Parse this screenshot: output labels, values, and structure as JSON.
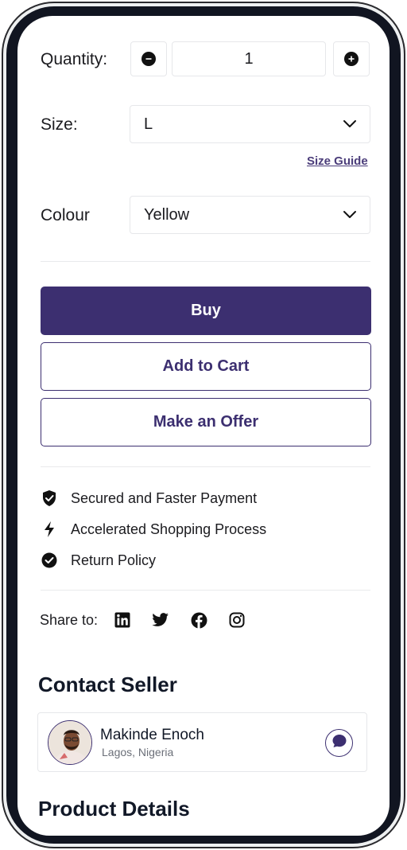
{
  "quantity": {
    "label": "Quantity:",
    "value": "1",
    "decrease_icon": "minus-circle-icon",
    "increase_icon": "plus-circle-icon"
  },
  "size": {
    "label": "Size:",
    "selected": "L",
    "guide_link": "Size Guide"
  },
  "colour": {
    "label": "Colour",
    "selected": "Yellow"
  },
  "actions": {
    "buy": "Buy",
    "add_to_cart": "Add to Cart",
    "make_offer": "Make an Offer"
  },
  "features": [
    {
      "icon": "shield-check-icon",
      "text": "Secured and Faster Payment"
    },
    {
      "icon": "lightning-icon",
      "text": "Accelerated Shopping Process"
    },
    {
      "icon": "check-circle-icon",
      "text": "Return Policy"
    }
  ],
  "share": {
    "label": "Share to:",
    "networks": [
      "linkedin-icon",
      "twitter-icon",
      "facebook-icon",
      "instagram-icon"
    ]
  },
  "contact_seller": {
    "title": "Contact Seller",
    "name": "Makinde Enoch",
    "location": "Lagos, Nigeria",
    "chat_icon": "chat-bubble-icon"
  },
  "product_details": {
    "title": "Product Details"
  },
  "colors": {
    "primary": "#3c2f70",
    "text": "#1b1b1f",
    "border": "#e6e7ea",
    "muted": "#6b6f78"
  }
}
